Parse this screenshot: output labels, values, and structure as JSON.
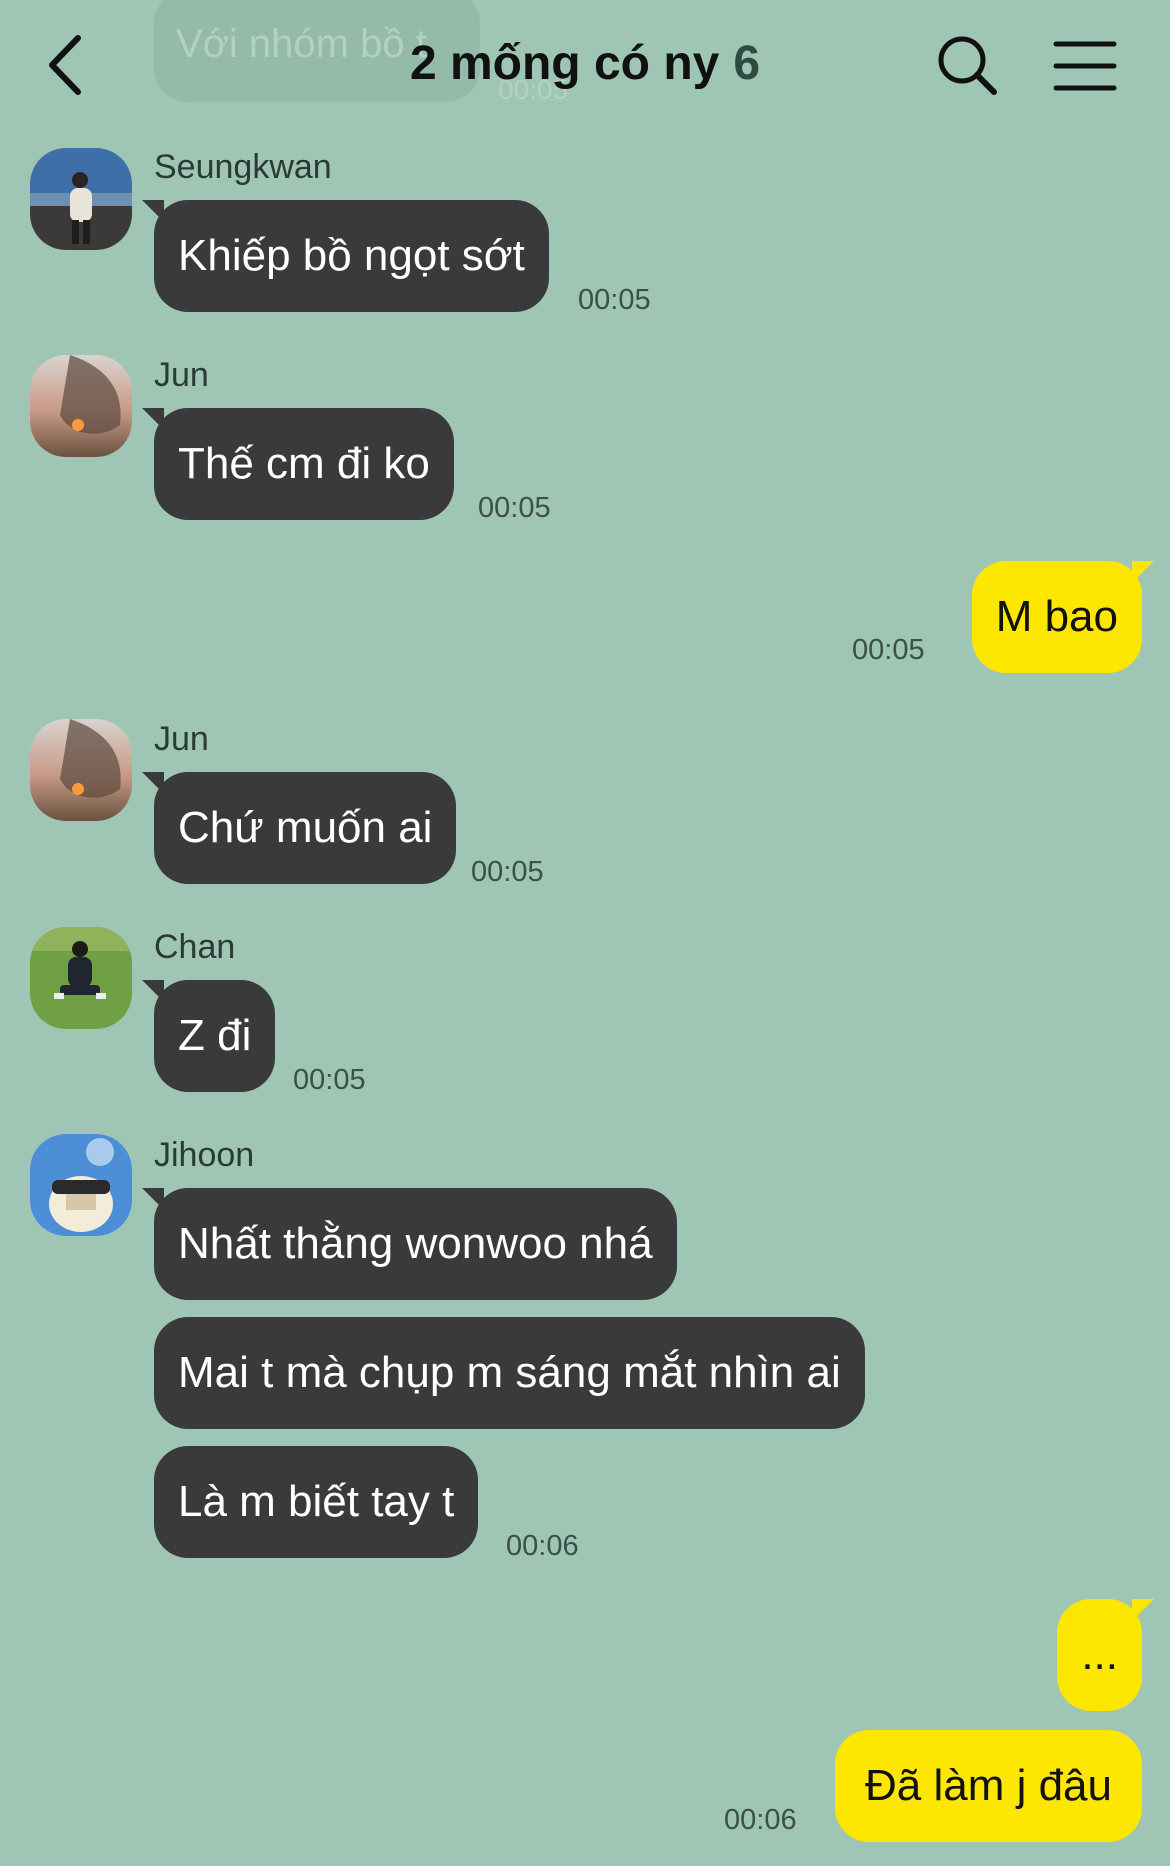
{
  "header": {
    "title": "2 mống có ny",
    "member_count": "6",
    "back_icon": "chevron-left-icon",
    "search_icon": "search-icon",
    "menu_icon": "menu-icon"
  },
  "faded_message": {
    "text": "Với nhóm bồ t",
    "time": "00:05"
  },
  "messages": [
    {
      "sender": "Seungkwan",
      "text": "Khiếp bồ ngọt sớt",
      "time": "00:05"
    },
    {
      "sender": "Jun",
      "text": "Thế cm đi ko",
      "time": "00:05"
    },
    {
      "sender": "me",
      "text": "M bao",
      "time": "00:05"
    },
    {
      "sender": "Jun",
      "text": "Chứ muốn ai",
      "time": "00:05"
    },
    {
      "sender": "Chan",
      "text": "Z đi",
      "time": "00:05"
    },
    {
      "sender": "Jihoon",
      "texts": [
        "Nhất thằng wonwoo nhá",
        "Mai t mà chụp m sáng mắt nhìn ai",
        "Là m biết tay t"
      ],
      "time": "00:06"
    },
    {
      "sender": "me",
      "texts": [
        "...",
        "Đã làm j đâu"
      ],
      "time": "00:06"
    }
  ],
  "colors": {
    "background": "#9fc6b5",
    "incoming_bubble": "#3a3a3c",
    "outgoing_bubble": "#fde600"
  }
}
